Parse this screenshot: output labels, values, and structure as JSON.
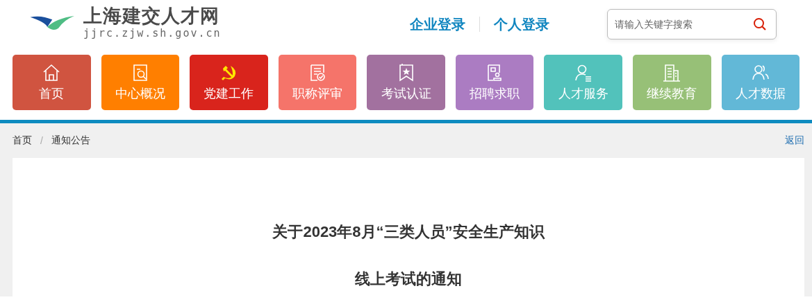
{
  "site": {
    "name": "上海建交人才网",
    "url": "jjrc.zjw.sh.gov.cn"
  },
  "logins": [
    "企业登录",
    "个人登录"
  ],
  "search": {
    "placeholder": "请输入关键字搜索"
  },
  "nav": [
    {
      "label": "首页",
      "color": "#d05440"
    },
    {
      "label": "中心概况",
      "color": "#ff7f00"
    },
    {
      "label": "党建工作",
      "color": "#d9241c"
    },
    {
      "label": "职称评审",
      "color": "#f5746a"
    },
    {
      "label": "考试认证",
      "color": "#a2719f"
    },
    {
      "label": "招聘求职",
      "color": "#ab7cc2"
    },
    {
      "label": "人才服务",
      "color": "#52c2bb"
    },
    {
      "label": "继续教育",
      "color": "#97c077"
    },
    {
      "label": "人才数据",
      "color": "#62b8d7"
    }
  ],
  "breadcrumb": [
    "首页",
    "通知公告"
  ],
  "breadcrumb_separator": "/",
  "back": "返回",
  "article": {
    "title_lines": [
      "关于2023年8月“三类人员”安全生产知识",
      "线上考试的通知"
    ]
  }
}
